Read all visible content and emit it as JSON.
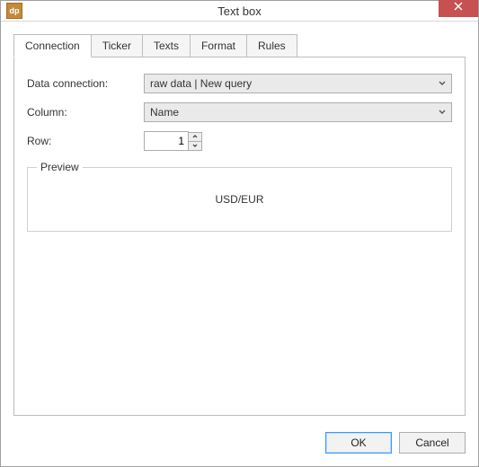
{
  "window": {
    "title": "Text box",
    "app_icon_text": "dp"
  },
  "tabs": [
    {
      "label": "Connection",
      "active": true
    },
    {
      "label": "Ticker",
      "active": false
    },
    {
      "label": "Texts",
      "active": false
    },
    {
      "label": "Format",
      "active": false
    },
    {
      "label": "Rules",
      "active": false
    }
  ],
  "form": {
    "data_connection_label": "Data connection:",
    "data_connection_value": "raw data | New query",
    "column_label": "Column:",
    "column_value": "Name",
    "row_label": "Row:",
    "row_value": "1"
  },
  "preview": {
    "legend": "Preview",
    "value": "USD/EUR"
  },
  "footer": {
    "ok_label": "OK",
    "cancel_label": "Cancel"
  }
}
